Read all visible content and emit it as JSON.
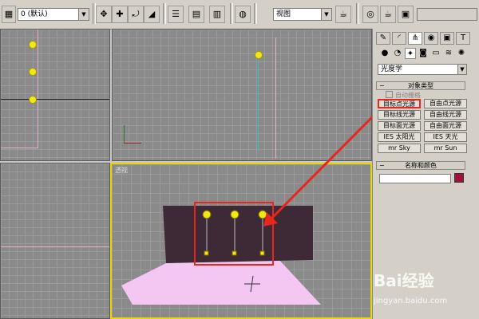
{
  "toolbar": {
    "selection_filter_value": "0 (默认)",
    "view_dropdown_value": "视图",
    "right_dropdown_value": ""
  },
  "viewports": {
    "perspective_label": "透视"
  },
  "panel": {
    "category_dropdown_value": "光度学",
    "object_type_title": "对象类型",
    "auto_grid_label": "自动栅格",
    "buttons": [
      "目标点光源",
      "自由点光源",
      "目标线光源",
      "自由线光源",
      "目标面光源",
      "自由面光源",
      "IES 太阳光",
      "IES 天光",
      "mr Sky",
      "mr Sun"
    ],
    "name_color_title": "名称和颜色",
    "name_value": ""
  },
  "colors": {
    "highlight_red": "#e8261c",
    "active_viewport": "#e7d600",
    "light_yellow": "#f1e816",
    "wall": "#3e2a36",
    "floor": "#f4c6f2",
    "swatch": "#a0123a"
  },
  "watermark": {
    "brand": "Bai经验",
    "url": "jingyan.baidu.com"
  }
}
